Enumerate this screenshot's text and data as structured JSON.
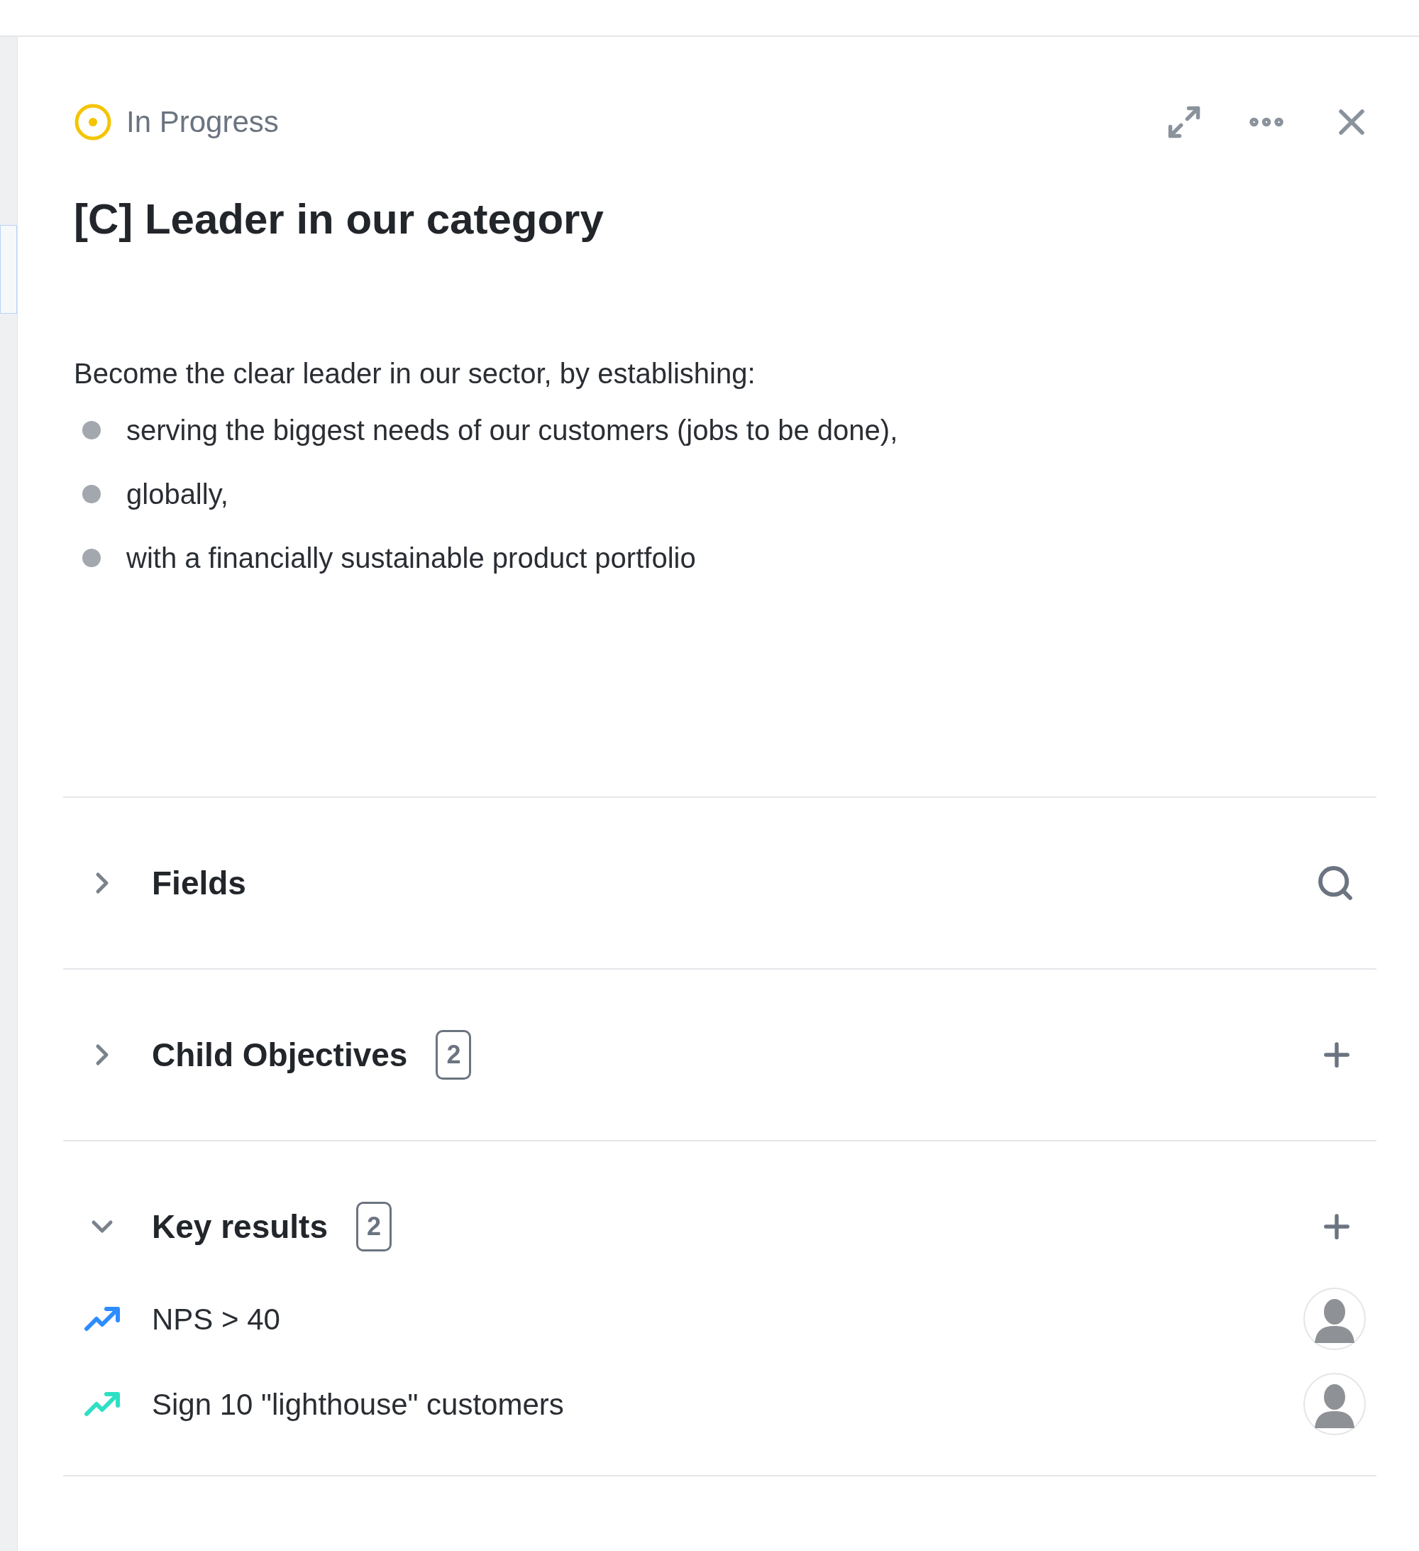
{
  "status": {
    "label": "In Progress"
  },
  "title": "[C] Leader in our category",
  "description": {
    "intro": "Become the clear leader in our sector, by establishing:",
    "bullets": [
      "serving the biggest needs of our customers (jobs to be done),",
      "globally,",
      "with a financially sustainable product portfolio"
    ]
  },
  "sections": [
    {
      "title": "Fields",
      "expanded": false,
      "kind": "search"
    },
    {
      "title": "Child Objectives",
      "expanded": false,
      "count": "2",
      "kind": "add"
    },
    {
      "title": "Key results",
      "expanded": true,
      "count": "2",
      "kind": "add",
      "items": [
        {
          "label": "NPS > 40",
          "color": "#2d8cff"
        },
        {
          "label": "Sign 10 \"lighthouse\" customers",
          "color": "#2ee0c4"
        }
      ]
    }
  ]
}
